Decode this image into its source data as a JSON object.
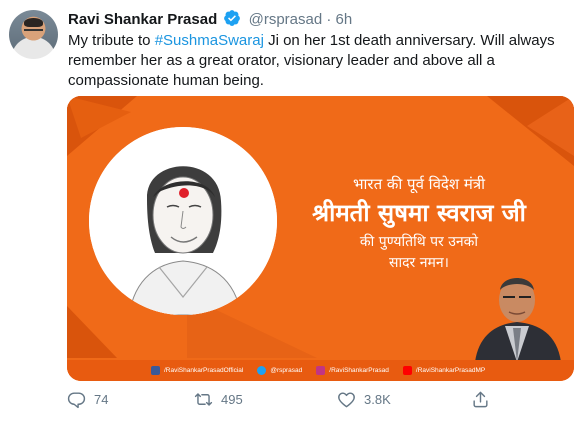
{
  "tweet": {
    "author_name": "Ravi Shankar Prasad",
    "handle": "@rsprasad",
    "separator": "·",
    "time": "6h",
    "text_before": "My tribute to ",
    "hashtag": "#SushmaSwaraj",
    "text_after": " Ji on her 1st  death anniversary. Will always remember her as a great orator, visionary leader and above all a compassionate human being."
  },
  "card": {
    "line1": "भारत की पूर्व विदेश मंत्री",
    "line2": "श्रीमती सुषमा स्वराज जी",
    "line3": "की पुण्यतिथि पर उनको",
    "line4": "सादर नमन।",
    "social": [
      {
        "icon": "facebook-icon",
        "label": "/RaviShankarPrasadOfficial",
        "color": "#3b5998"
      },
      {
        "icon": "twitter-icon",
        "label": "@rsprasad",
        "color": "#1da1f2"
      },
      {
        "icon": "instagram-icon",
        "label": "/RaviShankarPrasad",
        "color": "#c13584"
      },
      {
        "icon": "youtube-icon",
        "label": "/RaviShankarPrasadMP",
        "color": "#ff0000"
      }
    ]
  },
  "actions": {
    "replies": "74",
    "retweets": "495",
    "likes": "3.8K"
  },
  "colors": {
    "accent_blue": "#1b95e0",
    "card_orange": "#f06a18",
    "muted": "#657786"
  }
}
